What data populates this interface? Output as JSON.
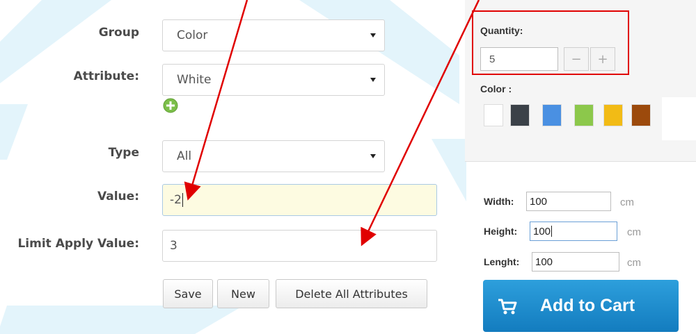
{
  "form": {
    "group_label": "Group",
    "group_value": "Color",
    "attribute_label": "Attribute:",
    "attribute_value": "White",
    "type_label": "Type",
    "type_value": "All",
    "value_label": "Value:",
    "value_value": "-2",
    "limit_label": "Limit Apply Value:",
    "limit_value": "3",
    "save_label": "Save",
    "new_label": "New",
    "delete_all_label": "Delete All Attributes",
    "add_icon": "plus-circle-icon"
  },
  "product": {
    "quantity_label": "Quantity:",
    "quantity_value": "5",
    "minus_symbol": "−",
    "plus_symbol": "+",
    "color_label": "Color :",
    "colors": [
      "#ffffff",
      "#3b4148",
      "#4a90e2",
      "#8cc84b",
      "#f2bb15",
      "#9c4a0c"
    ],
    "width_label": "Width:",
    "width_value": "100",
    "height_label": "Height:",
    "height_value": "100",
    "length_label": "Lenght:",
    "length_value": "100",
    "unit": "cm",
    "add_to_cart_label": "Add to Cart",
    "cart_icon": "shopping-cart-icon"
  },
  "colors": {
    "annotation_arrow": "#e00000",
    "annotation_box": "#e00000",
    "cart_button": "#1a8bd0",
    "background_shape": "#dff2fb"
  }
}
